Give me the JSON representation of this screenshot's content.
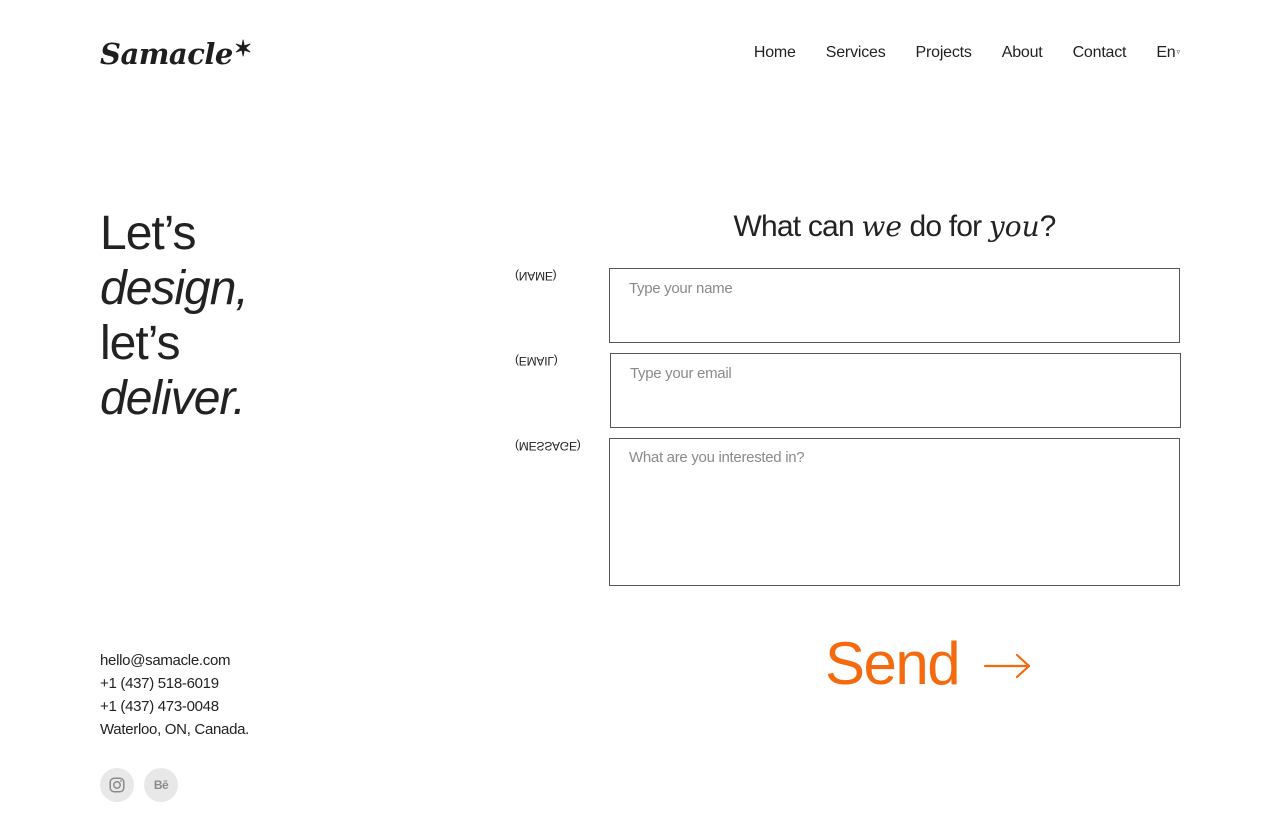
{
  "brand": {
    "name": "Samacle",
    "star": "✶"
  },
  "nav": {
    "items": [
      "Home",
      "Services",
      "Projects",
      "About",
      "Contact"
    ],
    "language": "En"
  },
  "hero": {
    "line1": "Let’s",
    "line2": "design,",
    "line3": "let’s",
    "line4": "deliver."
  },
  "contact": {
    "email": "hello@samacle.com",
    "phone1": "+1 (437) 518-6019",
    "phone2": "+1 (437) 473-0048",
    "address": "Waterloo, ON, Canada."
  },
  "socials": {
    "instagram_icon": "instagram-icon",
    "behance_label": "Bē"
  },
  "form": {
    "title_part1": "What can ",
    "title_we": "we",
    "title_part2": " do for ",
    "title_you": "you",
    "title_end": "?",
    "fields": {
      "name": {
        "label": "(NAME)",
        "placeholder": "Type your name"
      },
      "email": {
        "label": "(EMAIL)",
        "placeholder": "Type your email"
      },
      "message": {
        "label": "(MESSAGE)",
        "placeholder": "What are you interested in?"
      }
    },
    "send_label": "Send",
    "accent_color": "#f56a0e"
  }
}
